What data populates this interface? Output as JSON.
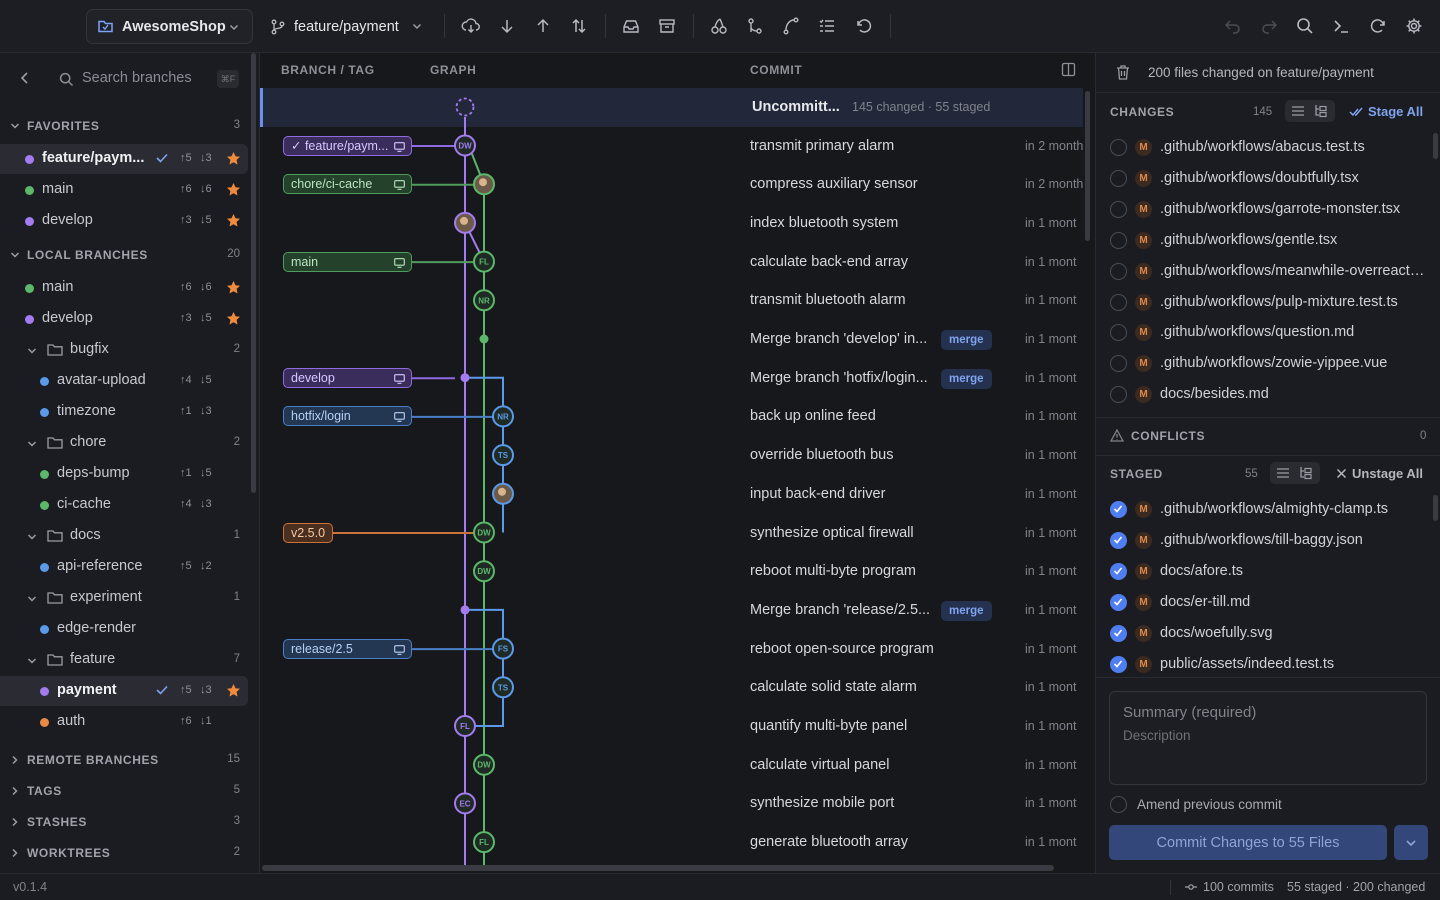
{
  "topbar": {
    "repo_name": "AwesomeShop",
    "branch_name": "feature/payment"
  },
  "sidebar": {
    "search_placeholder": "Search branches",
    "search_shortcut": "⌘F",
    "favorites": {
      "label": "FAVORITES",
      "count": "3",
      "items": [
        {
          "name": "feature/paym...",
          "ahead": "↑5",
          "behind": "↓3",
          "color": "#a47cf0",
          "selected": true,
          "current": true
        },
        {
          "name": "main",
          "ahead": "↑6",
          "behind": "↓6",
          "color": "#5bb86a"
        },
        {
          "name": "develop",
          "ahead": "↑3",
          "behind": "↓5",
          "color": "#a47cf0"
        }
      ]
    },
    "local": {
      "label": "LOCAL BRANCHES",
      "count": "20",
      "top": [
        {
          "name": "main",
          "ahead": "↑6",
          "behind": "↓6",
          "color": "#5bb86a"
        },
        {
          "name": "develop",
          "ahead": "↑3",
          "behind": "↓5",
          "color": "#a47cf0"
        }
      ],
      "folders": [
        {
          "name": "bugfix",
          "count": "2",
          "items": [
            {
              "name": "avatar-upload",
              "ahead": "↑4",
              "behind": "↓5",
              "color": "#5a9ae8"
            },
            {
              "name": "timezone",
              "ahead": "↑1",
              "behind": "↓3",
              "color": "#5a9ae8"
            }
          ]
        },
        {
          "name": "chore",
          "count": "2",
          "items": [
            {
              "name": "deps-bump",
              "ahead": "↑1",
              "behind": "↓5",
              "color": "#5bb86a"
            },
            {
              "name": "ci-cache",
              "ahead": "↑4",
              "behind": "↓3",
              "color": "#5bb86a"
            }
          ]
        },
        {
          "name": "docs",
          "count": "1",
          "items": [
            {
              "name": "api-reference",
              "ahead": "↑5",
              "behind": "↓2",
              "color": "#5a9ae8"
            }
          ]
        },
        {
          "name": "experiment",
          "count": "1",
          "items": [
            {
              "name": "edge-render",
              "ahead": "",
              "behind": "",
              "color": "#5a9ae8"
            }
          ]
        },
        {
          "name": "feature",
          "count": "7",
          "items": [
            {
              "name": "payment",
              "ahead": "↑5",
              "behind": "↓3",
              "color": "#a47cf0",
              "selected": true
            },
            {
              "name": "auth",
              "ahead": "↑6",
              "behind": "↓1",
              "color": "#e88a45"
            }
          ]
        }
      ]
    },
    "collapsed": [
      {
        "label": "REMOTE BRANCHES",
        "count": "15"
      },
      {
        "label": "TAGS",
        "count": "5"
      },
      {
        "label": "STASHES",
        "count": "3"
      },
      {
        "label": "WORKTREES",
        "count": "2"
      }
    ]
  },
  "graph": {
    "headers": {
      "branch": "BRANCH / TAG",
      "graph": "GRAPH",
      "commit": "COMMIT"
    },
    "uncommitted": {
      "title": "Uncommitt...",
      "meta": "145 changed · 55 staged"
    },
    "merge_badge": "merge",
    "commits": [
      {
        "msg": "transmit primary alarm",
        "time": "in 2 month",
        "ref": {
          "label": "✓ feature/paym...",
          "kind": "purple",
          "width": 129
        },
        "node": {
          "lane": 0,
          "initials": "DW",
          "color": "#a47cf0"
        }
      },
      {
        "msg": "compress auxiliary sensor",
        "time": "in 2 month",
        "ref": {
          "label": "chore/ci-cache",
          "kind": "green",
          "width": 129
        },
        "node": {
          "lane": 1,
          "avatar": true,
          "color": "#5bb86a"
        }
      },
      {
        "msg": "index bluetooth system",
        "time": "in 1 mont",
        "node": {
          "lane": 0,
          "avatar": true,
          "color": "#a47cf0"
        }
      },
      {
        "msg": "calculate back-end array",
        "time": "in 1 mont",
        "ref": {
          "label": "main",
          "kind": "green",
          "width": 129
        },
        "node": {
          "lane": 1,
          "initials": "FL",
          "color": "#5bb86a"
        }
      },
      {
        "msg": "transmit bluetooth alarm",
        "time": "in 1 mont",
        "node": {
          "lane": 1,
          "initials": "NR",
          "color": "#5bb86a"
        }
      },
      {
        "msg": "Merge branch 'develop' in...",
        "time": "in 1 mont",
        "merge": true,
        "node": {
          "lane": 1,
          "dot": true,
          "color": "#5bb86a"
        }
      },
      {
        "msg": "Merge branch 'hotfix/login...",
        "time": "in 1 mont",
        "merge": true,
        "ref": {
          "label": "develop",
          "kind": "purple",
          "width": 129
        },
        "node": {
          "lane": 0,
          "dot": true,
          "color": "#a47cf0"
        }
      },
      {
        "msg": "back up online feed",
        "time": "in 1 mont",
        "ref": {
          "label": "hotfix/login",
          "kind": "blue",
          "width": 129
        },
        "node": {
          "lane": 2,
          "initials": "NR",
          "color": "#5a9ae8"
        }
      },
      {
        "msg": "override bluetooth bus",
        "time": "in 1 mont",
        "node": {
          "lane": 2,
          "initials": "TS",
          "color": "#5a9ae8"
        }
      },
      {
        "msg": "input back-end driver",
        "time": "in 1 mont",
        "node": {
          "lane": 2,
          "avatar": true,
          "color": "#5a9ae8"
        }
      },
      {
        "msg": "synthesize optical firewall",
        "time": "in 1 mont",
        "ref": {
          "label": "v2.5.0",
          "kind": "orange",
          "width": 50
        },
        "node": {
          "lane": 1,
          "initials": "DW",
          "color": "#5bb86a"
        }
      },
      {
        "msg": "reboot multi-byte program",
        "time": "in 1 mont",
        "node": {
          "lane": 1,
          "initials": "DW",
          "color": "#5bb86a"
        }
      },
      {
        "msg": "Merge branch 'release/2.5...",
        "time": "in 1 mont",
        "merge": true,
        "node": {
          "lane": 0,
          "dot": true,
          "color": "#a47cf0"
        }
      },
      {
        "msg": "reboot open-source program",
        "time": "in 1 mont",
        "ref": {
          "label": "release/2.5",
          "kind": "blue",
          "width": 129
        },
        "node": {
          "lane": 2,
          "initials": "FS",
          "color": "#5a9ae8"
        }
      },
      {
        "msg": "calculate solid state alarm",
        "time": "in 1 mont",
        "node": {
          "lane": 2,
          "initials": "TS",
          "color": "#5a9ae8"
        }
      },
      {
        "msg": "quantify multi-byte panel",
        "time": "in 1 mont",
        "node": {
          "lane": 0,
          "initials": "FL",
          "color": "#a47cf0"
        }
      },
      {
        "msg": "calculate virtual panel",
        "time": "in 1 mont",
        "node": {
          "lane": 1,
          "initials": "DW",
          "color": "#5bb86a"
        }
      },
      {
        "msg": "synthesize mobile port",
        "time": "in 1 mont",
        "node": {
          "lane": 0,
          "initials": "EC",
          "color": "#a47cf0"
        }
      },
      {
        "msg": "generate bluetooth array",
        "time": "in 1 mont",
        "node": {
          "lane": 1,
          "initials": "FL",
          "color": "#5bb86a"
        }
      }
    ]
  },
  "right": {
    "header": "200 files changed on feature/payment",
    "changes": {
      "label": "CHANGES",
      "count": "145",
      "action": "Stage All",
      "files": [
        ".github/workflows/abacus.test.ts",
        ".github/workflows/doubtfully.tsx",
        ".github/workflows/garrote-monster.tsx",
        ".github/workflows/gentle.tsx",
        ".github/workflows/meanwhile-overreaction.ts",
        ".github/workflows/pulp-mixture.test.ts",
        ".github/workflows/question.md",
        ".github/workflows/zowie-yippee.vue",
        "docs/besides.md"
      ]
    },
    "conflicts": {
      "label": "CONFLICTS",
      "count": "0"
    },
    "staged": {
      "label": "STAGED",
      "count": "55",
      "action": "Unstage All",
      "files": [
        ".github/workflows/almighty-clamp.ts",
        ".github/workflows/till-baggy.json",
        "docs/afore.ts",
        "docs/er-till.md",
        "docs/woefully.svg",
        "public/assets/indeed.test.ts"
      ]
    },
    "file_status": "M",
    "summary_placeholder": "Summary (required)",
    "description_placeholder": "Description",
    "amend_label": "Amend previous commit",
    "commit_button": "Commit Changes to 55 Files"
  },
  "status": {
    "version": "v0.1.4",
    "commits": "100 commits",
    "changes": "55 staged · 200 changed"
  },
  "colors": {
    "accent": "#4f7ef0",
    "purple": "#a47cf0",
    "green": "#5bb86a",
    "blue": "#5a9ae8",
    "orange": "#e88a45",
    "star": "#f08a3c"
  }
}
